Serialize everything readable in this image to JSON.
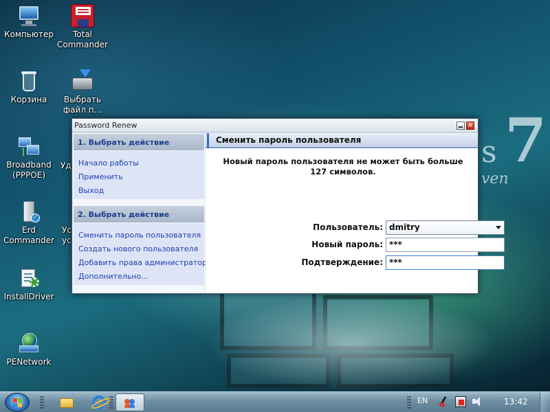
{
  "desktop": {
    "icons": [
      {
        "label": "Компьютер",
        "icon": "computer-icon"
      },
      {
        "label": "Total Commander",
        "icon": "floppy-icon"
      },
      {
        "label": "Корзина",
        "icon": "recycle-bin-icon"
      },
      {
        "label": "Выбрать файл п...",
        "icon": "select-file-icon"
      },
      {
        "label": "Broadband (PPPOE)",
        "icon": "network-connection-icon"
      },
      {
        "label": "Erd Commander",
        "icon": "erd-commander-icon"
      },
      {
        "label": "InstallDriver",
        "icon": "install-driver-icon"
      },
      {
        "label": "PENetwork",
        "icon": "pe-network-icon"
      }
    ],
    "partial_icons": [
      {
        "label": "Уд"
      },
      {
        "label": "Ус уст"
      }
    ],
    "wallpaper_brand": {
      "big": "7",
      "small": "s",
      "edition": "ven"
    }
  },
  "window": {
    "title": "Password Renew",
    "controls": {
      "minimize": "minimize-icon",
      "close": "close-icon",
      "close_glyph": "✕"
    },
    "sidebar": {
      "sections": [
        {
          "title": "1. Выбрать действие",
          "links": [
            "Начало работы",
            "Применить",
            "Выход"
          ]
        },
        {
          "title": "2. Выбрать действие",
          "links": [
            "Сменить пароль пользователя",
            "Создать нового пользователя",
            "Добавить права администратора",
            "Дополнительно..."
          ]
        }
      ]
    },
    "main": {
      "heading": "Сменить пароль пользователя",
      "info": "Новый пароль пользователя не может быть больше 127 символов.",
      "form": {
        "user_label": "Пользователь:",
        "user_value": "dmitry",
        "new_password_label": "Новый пароль:",
        "new_password_value": "***",
        "confirm_label": "Подтверждение:",
        "confirm_value": "***"
      }
    }
  },
  "taskbar": {
    "start": "start-icon",
    "pinned": [
      "explorer-folder-icon",
      "internet-explorer-icon"
    ],
    "running": [
      "password-renew-task-icon"
    ],
    "tray": {
      "language": "EN",
      "icons": [
        "cleanup-icon",
        "network-tray-icon",
        "volume-icon"
      ],
      "clock": "13:42"
    }
  },
  "colors": {
    "accent": "#1e3f8c",
    "link": "#1f3fae",
    "section_header": "#aab7c9",
    "section_body": "#dce4f6"
  }
}
